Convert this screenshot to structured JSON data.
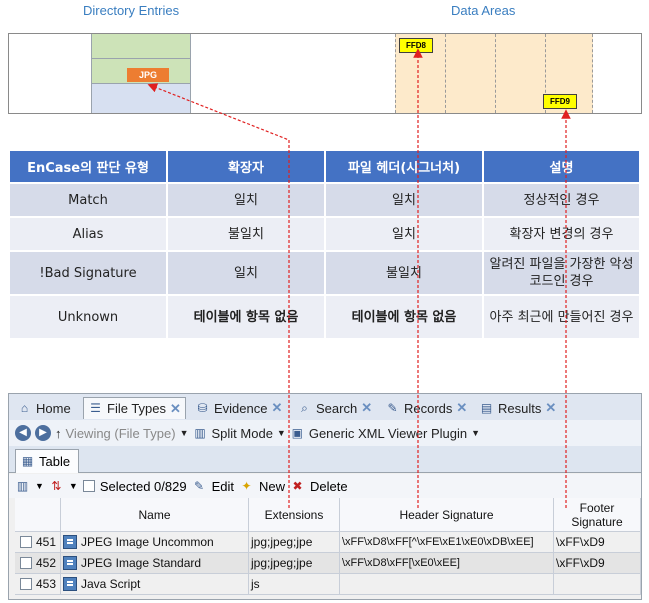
{
  "diagram": {
    "caption_directory": "Directory Entries",
    "caption_data": "Data Areas",
    "jpg_label": "JPG",
    "ffd8_label": "FFD8",
    "ffd9_label": "FFD9"
  },
  "enc_table": {
    "headers": [
      "EnCase의 판단 유형",
      "확장자",
      "파일 헤더(시그너처)",
      "설명"
    ],
    "rows": [
      {
        "type": "Match",
        "ext": "일치",
        "header": "일치",
        "desc": "정상적인 경우"
      },
      {
        "type": "Alias",
        "ext": "불일치",
        "header": "일치",
        "desc": "확장자 변경의 경우"
      },
      {
        "type": "!Bad Signature",
        "ext": "일치",
        "header": "불일치",
        "desc": "알려진 파일을 가장한 악성코드인 경우"
      },
      {
        "type": "Unknown",
        "ext": "테이블에 항목 없음",
        "header": "테이블에 항목 없음",
        "desc": "아주 최근에 만들어진 경우"
      }
    ]
  },
  "app": {
    "tabs": [
      "Home",
      "File Types",
      "Evidence",
      "Search",
      "Records",
      "Results"
    ],
    "toolbar1": {
      "viewing": "Viewing (File Type)",
      "split_mode": "Split Mode",
      "plugin": "Generic XML Viewer Plugin"
    },
    "sub_tab": "Table",
    "toolbar2": {
      "selected": "Selected 0/829",
      "edit": "Edit",
      "new": "New",
      "delete": "Delete"
    },
    "columns": [
      "Name",
      "Extensions",
      "Header Signature",
      "Footer Signature"
    ],
    "rows": [
      {
        "num": "451",
        "name": "JPEG Image Uncommon",
        "ext": "jpg;jpeg;jpe",
        "header": "\\xFF\\xD8\\xFF[^\\xFE\\xE1\\xE0\\xDB\\xEE]",
        "footer": "\\xFF\\xD9"
      },
      {
        "num": "452",
        "name": "JPEG Image Standard",
        "ext": "jpg;jpeg;jpe",
        "header": "\\xFF\\xD8\\xFF[\\xE0\\xEE]",
        "footer": "\\xFF\\xD9"
      },
      {
        "num": "453",
        "name": "Java Script",
        "ext": "js",
        "header": "",
        "footer": ""
      }
    ]
  }
}
